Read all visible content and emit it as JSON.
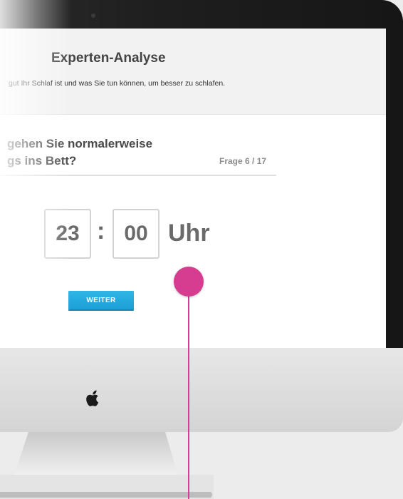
{
  "header": {
    "title": "Experten-Analyse",
    "subtitle": "gut Ihr Schlaf ist und was Sie tun können, um besser zu schlafen."
  },
  "question": {
    "line1": "gehen Sie normalerweise",
    "line2": "gs ins Bett?",
    "progress": "Frage 6 / 17"
  },
  "time": {
    "hours": "23",
    "separator": ":",
    "minutes": "00",
    "unit": "Uhr"
  },
  "actions": {
    "next_label": "WEITER"
  },
  "colors": {
    "accent_button": "#1d9fd6",
    "marker": "#d63c8f"
  }
}
